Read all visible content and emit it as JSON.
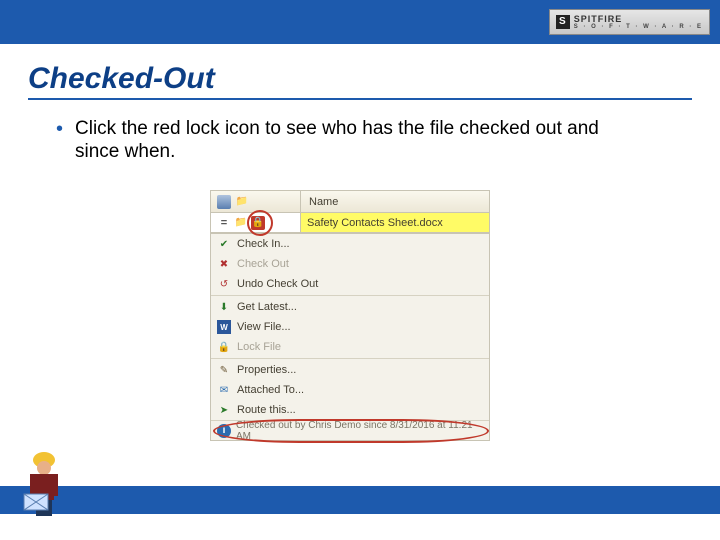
{
  "brand": {
    "name": "SPITFIRE",
    "sub": "S · O · F · T · W · A · R · E",
    "badge": "S"
  },
  "slide": {
    "title": "Checked-Out",
    "bullet": "Click the red lock icon to see who has the file checked out and since when."
  },
  "app": {
    "columns": {
      "name": "Name"
    },
    "file": {
      "name": "Safety Contacts Sheet.docx"
    },
    "menu": {
      "checkin": "Check In...",
      "checkout": "Check Out",
      "undo": "Undo Check Out",
      "getlatest": "Get Latest...",
      "viewfile": "View File...",
      "lockfile": "Lock File",
      "properties": "Properties...",
      "attached": "Attached To...",
      "route": "Route this..."
    },
    "status": "Checked out by Chris Demo since 8/31/2016 at 11:21 AM"
  }
}
